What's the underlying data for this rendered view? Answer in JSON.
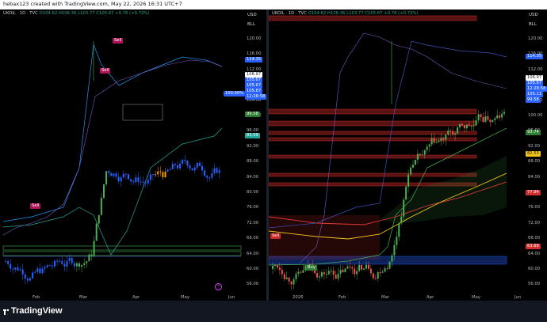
{
  "top_bar": {
    "text": "hebax123 created with TradingView.com, May 22, 2026 16:31 UTC+7"
  },
  "left_chart": {
    "header": {
      "symbol": "UKOIL · 1D · TVC",
      "ohlc": "O104.62 H106.36 L103.77 C105.67 +0.76 (+0.72%)"
    },
    "currency": "USD",
    "scale_mode": "BLL",
    "y_ticks": [
      "120.00",
      "116.00",
      "112.00",
      "108.00",
      "104.00",
      "100.00",
      "96.00",
      "92.00",
      "88.00",
      "84.00",
      "80.00",
      "76.00",
      "72.00",
      "68.00",
      "64.00",
      "60.00",
      "56.00"
    ],
    "price_labels": [
      {
        "text": "114.35",
        "color": "#2962ff"
      },
      {
        "text": "106.97",
        "color": "#131722"
      },
      {
        "text": "105.67",
        "color": "#2962ff"
      },
      {
        "text": "105.67",
        "color": "#2962ff"
      },
      {
        "text": "105.67",
        "color": "#2962ff"
      },
      {
        "text": "12:28:58",
        "color": "#2962ff"
      },
      {
        "text": "99.58",
        "color": "#2e7d32"
      },
      {
        "text": "93.59",
        "color": "#26a69a"
      }
    ],
    "cursor_label": "100.00%",
    "x_ticks": [
      "Feb",
      "Mar",
      "Apr",
      "May",
      "Jun"
    ],
    "signals": [
      "Sell",
      "Sell",
      "Sell"
    ],
    "alert_icon": "lightning-icon",
    "volume_profile": true
  },
  "right_chart": {
    "header": {
      "symbol": "UKOIL · 1D · TVC",
      "ohlc": "O104.62 H106.36 L103.77 C105.67 +0.76 (+0.72%)"
    },
    "currency": "USD",
    "scale_mode": "BLL",
    "y_ticks": [
      "120.00",
      "116.00",
      "112.00",
      "108.00",
      "104.00",
      "100.00",
      "96.00",
      "92.00",
      "88.00",
      "84.00",
      "80.00",
      "76.00",
      "72.00",
      "68.00",
      "64.00",
      "60.00",
      "56.00"
    ],
    "price_labels": [
      {
        "text": "114.35",
        "color": "#2962ff"
      },
      {
        "text": "106.97",
        "color": "#131722"
      },
      {
        "text": "105.67",
        "color": "#2962ff"
      },
      {
        "text": "12:28:58",
        "color": "#2962ff"
      },
      {
        "text": "105.11",
        "color": "#2962ff"
      },
      {
        "text": "99.58",
        "color": "#2962ff"
      },
      {
        "text": "93.74",
        "color": "#2e7d32"
      },
      {
        "text": "82.53",
        "color": "#f5c518"
      },
      {
        "text": "77.94",
        "color": "#d32f2f"
      },
      {
        "text": "63.69",
        "color": "#d32f2f"
      }
    ],
    "x_ticks": [
      "2026",
      "Feb",
      "Mar",
      "Apr",
      "May",
      "Jun"
    ],
    "signals": [
      "Sell",
      "Buy"
    ]
  },
  "footer": {
    "brand": "TradingView"
  },
  "colors": {
    "up": "#2962ff",
    "down": "#ef5350",
    "green": "#4caf50",
    "purple": "#9c27b0",
    "yellow": "#f5c518"
  }
}
